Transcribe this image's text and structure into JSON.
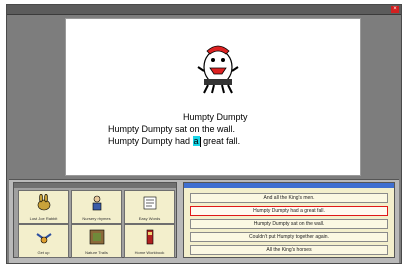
{
  "window": {
    "title": ""
  },
  "document": {
    "line1": "Humpty Dumpty",
    "line2": "Humpty Dumpty sat on the wall.",
    "line3_a": "Humpty Dumpty had ",
    "line3_hl": "a",
    "line3_b": " great fall."
  },
  "symbols": [
    {
      "label": "Lost Joe Rabbit",
      "icon": "rabbit-icon"
    },
    {
      "label": "Nursery rhymes",
      "icon": "person-icon"
    },
    {
      "label": "Easy Words",
      "icon": "words-icon"
    },
    {
      "label": "Get up",
      "icon": "bird-icon"
    },
    {
      "label": "Nature Trails",
      "icon": "tree-icon"
    },
    {
      "label": "Home Workbook",
      "icon": "book-icon"
    }
  ],
  "choices": [
    "And all the King's men.",
    "Humpty Dumpty had a great fall.",
    "Humpty Dumpty sat on the wall.",
    "Couldn't put Humpty together again.",
    "All the King's horses"
  ],
  "colors": {
    "highlight": "#18d6e8",
    "selected_border": "#e01818",
    "cell_bg": "#f3efcc"
  }
}
